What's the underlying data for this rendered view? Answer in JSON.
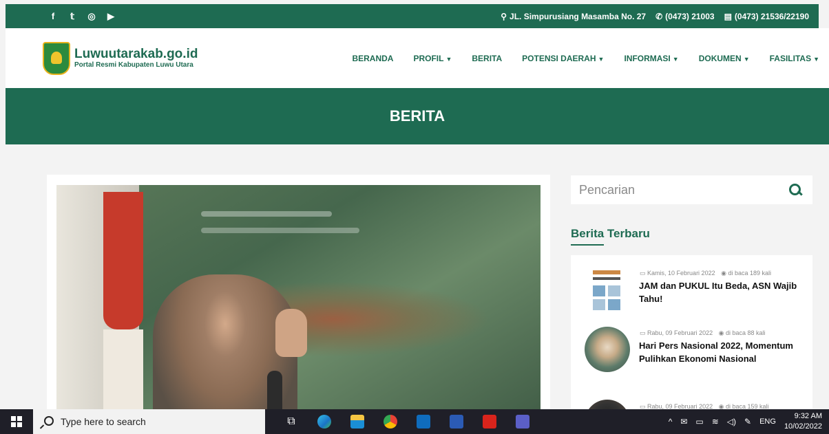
{
  "topbar": {
    "social": [
      {
        "icon": "facebook-icon",
        "glyph": "f"
      },
      {
        "icon": "twitter-icon",
        "glyph": "🐦"
      },
      {
        "icon": "instagram-icon",
        "glyph": "◎"
      },
      {
        "icon": "youtube-icon",
        "glyph": "▶"
      }
    ],
    "address": "JL. Simpurusiang Masamba No. 27",
    "phone": "(0473) 21003",
    "fax": "(0473) 21536/22190"
  },
  "navbar": {
    "logo_title": "Luwuutarakab.go.id",
    "logo_subtitle": "Portal Resmi Kabupaten Luwu Utara",
    "menu": [
      {
        "label": "BERANDA",
        "dropdown": false
      },
      {
        "label": "PROFIL",
        "dropdown": true
      },
      {
        "label": "BERITA",
        "dropdown": false
      },
      {
        "label": "POTENSI DAERAH",
        "dropdown": true
      },
      {
        "label": "INFORMASI",
        "dropdown": true
      },
      {
        "label": "DOKUMEN",
        "dropdown": true
      },
      {
        "label": "FASILITAS",
        "dropdown": true
      }
    ]
  },
  "banner": {
    "title": "BERITA"
  },
  "sidebar": {
    "search_placeholder": "Pencarian",
    "section_title": "Berita Terbaru",
    "news": [
      {
        "date": "Kamis, 10 Februari 2022",
        "views": "di baca 189 kali",
        "title": "JAM dan PUKUL Itu Beda, ASN Wajib Tahu!"
      },
      {
        "date": "Rabu, 09 Februari 2022",
        "views": "di baca 88 kali",
        "title": "Hari Pers Nasional 2022, Momentum Pulihkan Ekonomi Nasional"
      },
      {
        "date": "Rabu, 09 Februari 2022",
        "views": "di baca 159 kali",
        "title": ""
      }
    ]
  },
  "taskbar": {
    "search_placeholder": "Type here to search",
    "language": "ENG",
    "time": "9:32 AM",
    "date": "10/02/2022"
  },
  "colors": {
    "brand": "#1e6b52",
    "taskbar": "#1f1f28"
  }
}
